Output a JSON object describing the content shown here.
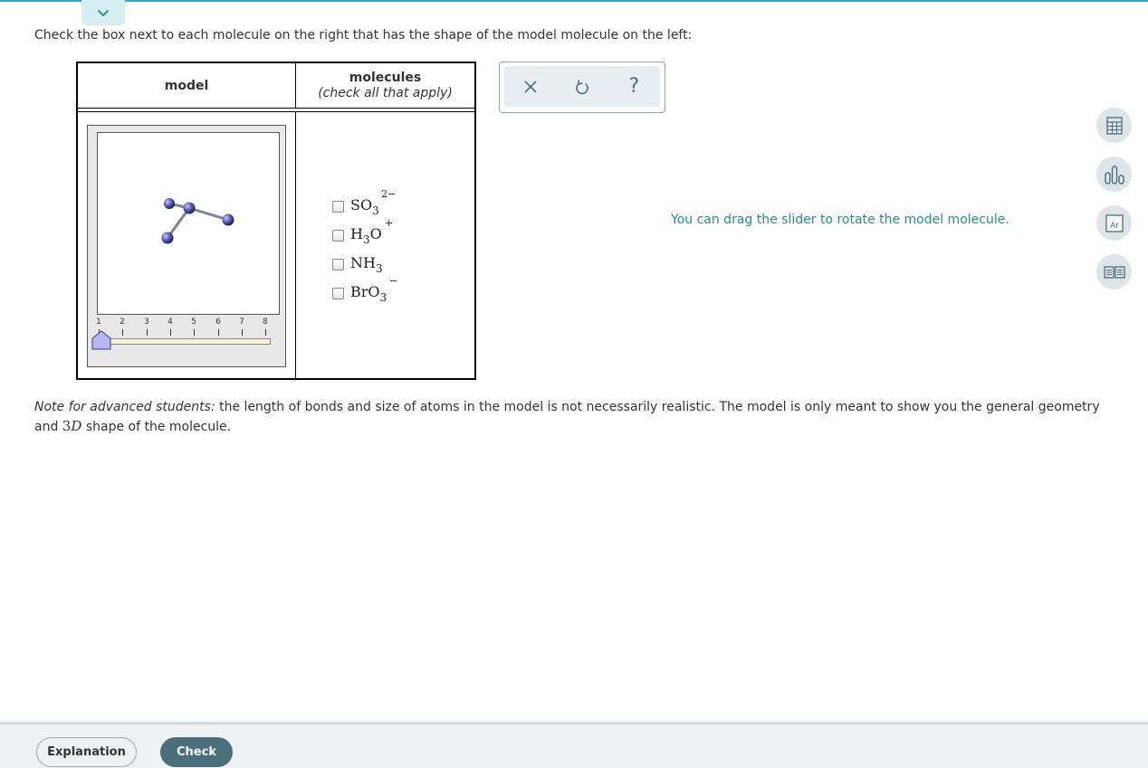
{
  "instructions": "Check the box next to each molecule on the right that has the shape of the model molecule on the left:",
  "table": {
    "col_model": "model",
    "col_molecules": "molecules",
    "col_molecules_sub": "(check all that apply)"
  },
  "slider": {
    "ticks": [
      "1",
      "2",
      "3",
      "4",
      "5",
      "6",
      "7",
      "8"
    ],
    "value": 1
  },
  "molecules": [
    {
      "base": "SO",
      "sub": "3",
      "charge": "2−",
      "checked": false
    },
    {
      "base": "H",
      "sub": "3",
      "tail": "O",
      "charge": "+",
      "checked": false
    },
    {
      "base": "NH",
      "sub": "3",
      "charge": "",
      "checked": false
    },
    {
      "base": "BrO",
      "sub": "3",
      "charge": "−",
      "checked": false
    }
  ],
  "toolbox": {
    "icons": [
      "close-icon",
      "undo-icon",
      "help-icon"
    ],
    "help_label": "?"
  },
  "hint": "You can drag the slider to rotate the model molecule.",
  "note": {
    "lead": "Note for advanced students:",
    "text1": " the length of bonds and size of atoms in the model is not necessarily realistic. The model is only meant to show you the general geometry and ",
    "math_num": "3",
    "math_var": "D",
    "text2": " shape of the molecule."
  },
  "side_tools": [
    "calculator-icon",
    "chart-icon",
    "periodic-table-icon",
    "reference-book-icon"
  ],
  "periodic_symbol": "Ar",
  "footer": {
    "explanation": "Explanation",
    "check": "Check"
  },
  "colors": {
    "accent": "#34a8b4",
    "check_button": "#4a6f7a",
    "hint_text": "#2c8a8a",
    "slider_handle": "#b8b8f0"
  }
}
